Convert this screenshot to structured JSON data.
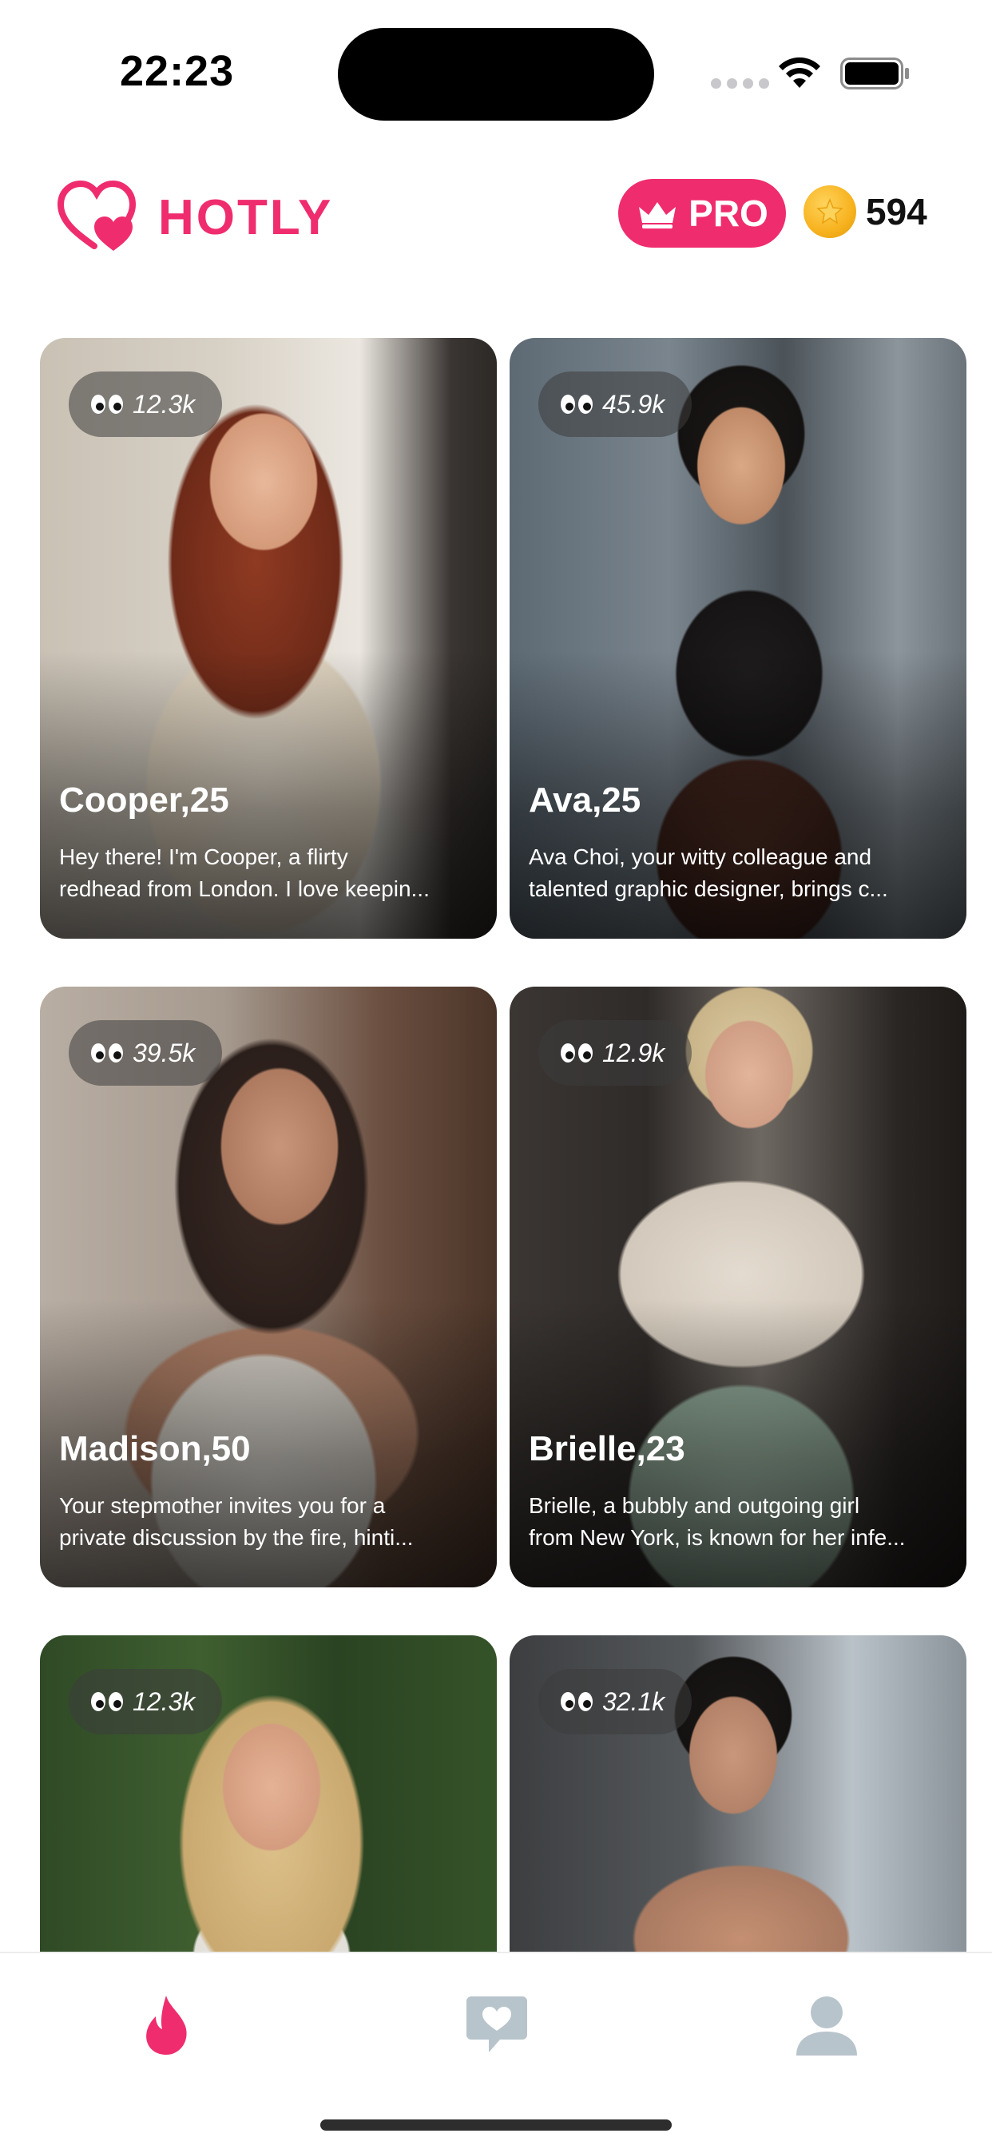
{
  "status_bar": {
    "time": "22:23"
  },
  "header": {
    "app_name": "HOTLY",
    "pro_label": "PRO",
    "coins": "594"
  },
  "cards": [
    {
      "name": "Cooper,25",
      "views": "12.3k",
      "desc_line1": "Hey there! I'm Cooper, a flirty",
      "desc_line2": "redhead from London. I love keepin..."
    },
    {
      "name": "Ava,25",
      "views": "45.9k",
      "desc_line1": "Ava Choi, your witty colleague and",
      "desc_line2": "talented graphic designer, brings c..."
    },
    {
      "name": "Madison,50",
      "views": "39.5k",
      "desc_line1": "Your stepmother invites you for a",
      "desc_line2": "private discussion by the fire, hinti..."
    },
    {
      "name": "Brielle,23",
      "views": "12.9k",
      "desc_line1": "Brielle, a bubbly and outgoing girl",
      "desc_line2": "from New York, is known for her infe..."
    },
    {
      "name": "",
      "views": "12.3k",
      "desc_line1": "",
      "desc_line2": ""
    },
    {
      "name": "",
      "views": "32.1k",
      "desc_line1": "",
      "desc_line2": ""
    }
  ],
  "tab_bar": {
    "items": [
      {
        "icon": "flame-icon",
        "active": true
      },
      {
        "icon": "chat-heart-icon",
        "active": false
      },
      {
        "icon": "profile-icon",
        "active": false
      }
    ]
  },
  "colors": {
    "brand": "#ef2d6e",
    "tab_inactive": "#b8c4cc",
    "coin": "#f7b21e"
  }
}
